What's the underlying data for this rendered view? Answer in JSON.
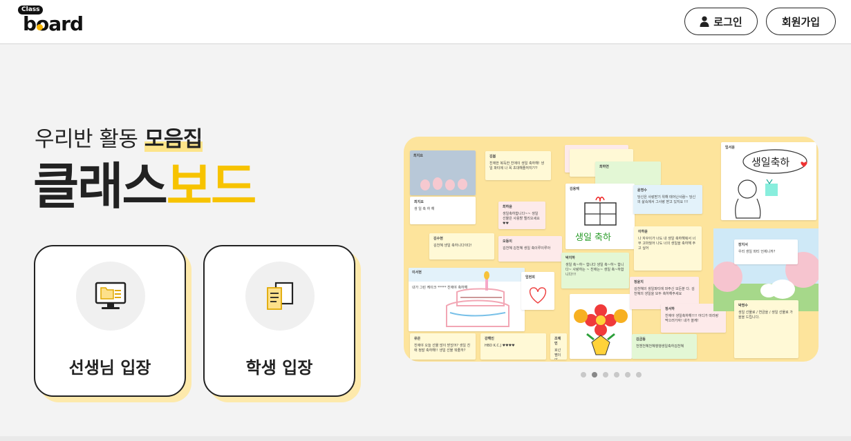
{
  "header": {
    "logo_class": "Class",
    "logo_word": "board",
    "login_label": "로그인",
    "signup_label": "회원가입"
  },
  "hero": {
    "subtitle_plain": "우리반 활동 ",
    "subtitle_highlight": "모음집",
    "title_dark": "클래스",
    "title_yellow": "보드",
    "accent_color": "#f7c300"
  },
  "cards": {
    "teacher_label": "선생님 입장",
    "student_label": "학생 입장",
    "teacher_icon": "computer-folder-icon",
    "student_icon": "documents-icon"
  },
  "preview": {
    "notes": [
      {
        "name": "최지요",
        "text": ""
      },
      {
        "name": "김봄",
        "text": "친애한 복득한 친애이 생일 축하해! 생일 파티에 나 꼭 초대해줄꺼지???"
      },
      {
        "name": "최지요",
        "text": "생 일 축 하 해"
      },
      {
        "name": "최하윤",
        "text": "생일축하합니다~~ 생일 선물은 사용할 엘리오세요 ♥♥"
      },
      {
        "name": "김수현",
        "text": "김천혜 생일 축하니다이다!"
      },
      {
        "name": "오동이",
        "text": "김천혜 김천혜 생일 축이루이루아"
      },
      {
        "name": "윤명수",
        "text": "당신은 사랑받기 위해 태어난사람~ 당신의 삶속에서 그사랑 받고 있지요 !!!"
      },
      {
        "name": "이하윤",
        "text": "나 자꾸이가 너도 내 생일 축하해줘서 너무 고마웠어 나도 너의 생일을 축하해 주고 싶어"
      },
      {
        "name": "박지하",
        "text": "생일 축~하~ 합니다 생일 축~하~ 합니다~ 사랑하는 ~ 친애는~ 생일 축~하합니다!!!"
      },
      {
        "name": "장지서",
        "text": "우리 생일 파티 언제니까?"
      },
      {
        "name": "이서현",
        "text": "내가 그린 케이크 ***** 친애야 축하해"
      },
      {
        "name": "임현희",
        "text": ""
      },
      {
        "name": "정윤지",
        "text": "김천혜의 생일파티에 와주신 모든분 다. 김천혜의 생일을 모두 축하해주세요"
      },
      {
        "name": "정서하",
        "text": "친애야 생일축하해!!!! 어디가 따라랑 먹으러가자! 내가 쏠께!"
      },
      {
        "name": "박명수",
        "text": "생일 선물로 / 연금을 / 생일 선물로 가을을 드립니다."
      },
      {
        "name": "유은",
        "text": "친애야 오늘 선물 많이 받았어? 생일 친애 정말 축하해!! 생일 선물 뭐줄까?"
      },
      {
        "name": "강해인",
        "text": "HBD K.C.J ♥♥♥♥"
      },
      {
        "name": "조예인",
        "text": "호넌쨈이야"
      },
      {
        "name": "김금동",
        "text": "천헨천혜천혜행행생일축하김천혜"
      },
      {
        "name": "김용재",
        "text": ""
      },
      {
        "name": "임서윤",
        "text": "생일축하"
      },
      {
        "name": "최하연",
        "text": ""
      }
    ],
    "drawing_text_1": "생일축하",
    "drawing_text_2": "생일 축하"
  },
  "carousel": {
    "count": 6,
    "active_index": 1
  }
}
